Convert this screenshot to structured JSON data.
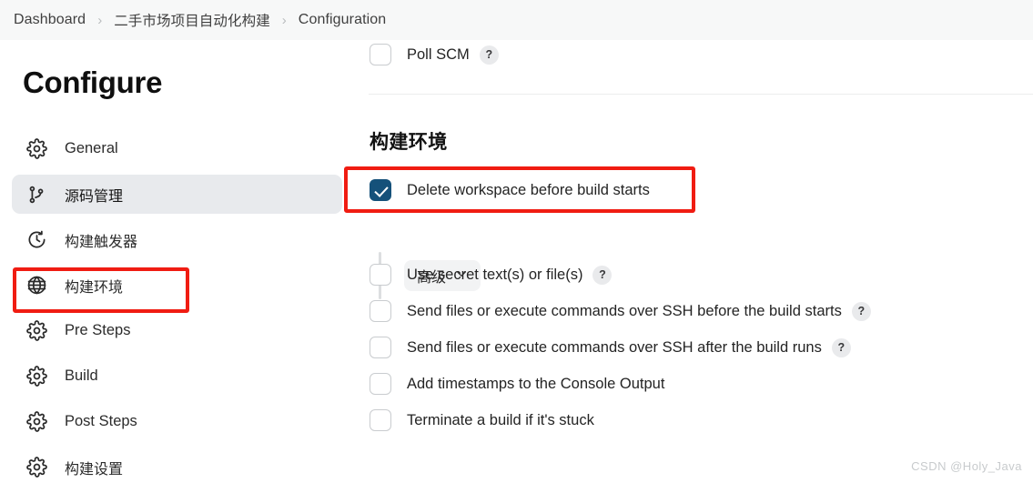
{
  "breadcrumb": {
    "items": [
      {
        "label": "Dashboard"
      },
      {
        "label": "二手市场项目自动化构建"
      },
      {
        "label": "Configuration"
      }
    ],
    "separator": "›"
  },
  "sidebar": {
    "title": "Configure",
    "items": [
      {
        "label": "General",
        "icon": "gear-icon",
        "active": false,
        "cn": false
      },
      {
        "label": "源码管理",
        "icon": "branch-icon",
        "active": true,
        "cn": true
      },
      {
        "label": "构建触发器",
        "icon": "clock-icon",
        "active": false,
        "cn": true
      },
      {
        "label": "构建环境",
        "icon": "globe-icon",
        "active": false,
        "cn": true
      },
      {
        "label": "Pre Steps",
        "icon": "gear-icon",
        "active": false,
        "cn": false
      },
      {
        "label": "Build",
        "icon": "gear-icon",
        "active": false,
        "cn": false
      },
      {
        "label": "Post Steps",
        "icon": "gear-icon",
        "active": false,
        "cn": false
      },
      {
        "label": "构建设置",
        "icon": "gear-icon",
        "active": false,
        "cn": true
      }
    ]
  },
  "main": {
    "poll_scm": {
      "label": "Poll SCM",
      "checked": false,
      "help": "?"
    },
    "section_title": "构建环境",
    "delete_workspace": {
      "label": "Delete workspace before build starts",
      "checked": true
    },
    "advanced_button": {
      "label": "高级",
      "chevron": "chevron-down-icon"
    },
    "options": [
      {
        "label": "Use secret text(s) or file(s)",
        "checked": false,
        "help": "?"
      },
      {
        "label": "Send files or execute commands over SSH before the build starts",
        "checked": false,
        "help": "?"
      },
      {
        "label": "Send files or execute commands over SSH after the build runs",
        "checked": false,
        "help": "?"
      },
      {
        "label": "Add timestamps to the Console Output",
        "checked": false,
        "help": ""
      },
      {
        "label": "Terminate a build if it's stuck",
        "checked": false,
        "help": ""
      }
    ]
  },
  "annotations": {
    "color": "#f01c12",
    "boxes": [
      {
        "name": "sidebar-build-env-highlight"
      },
      {
        "name": "delete-workspace-highlight"
      }
    ]
  },
  "watermark": {
    "text": "CSDN @Holy_Java"
  }
}
